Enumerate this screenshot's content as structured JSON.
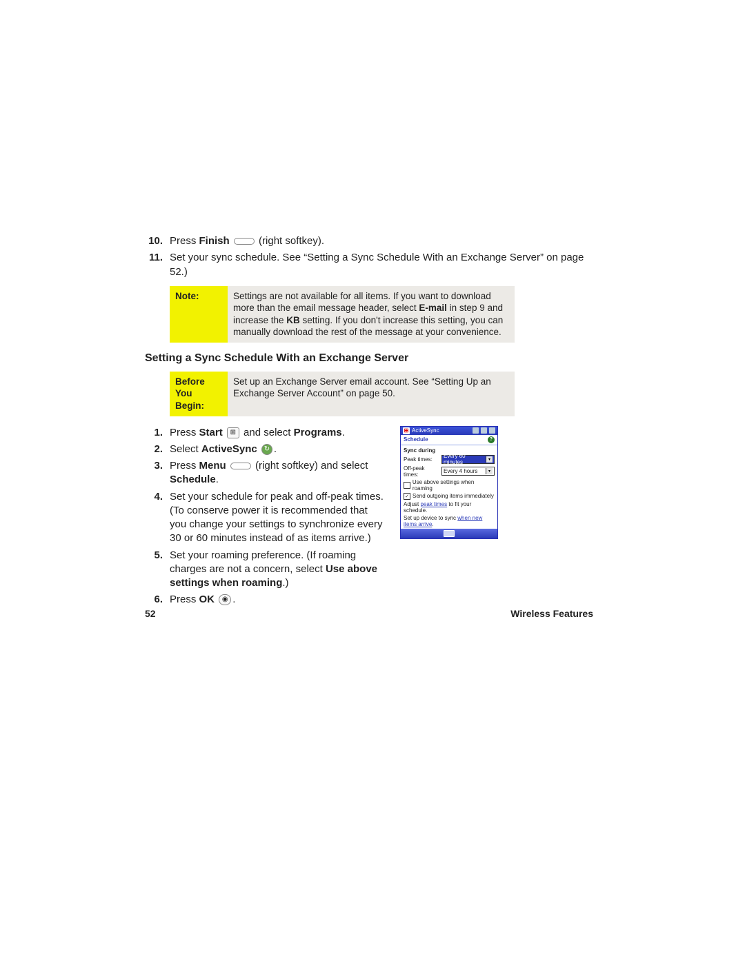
{
  "top_steps": [
    {
      "num": "10.",
      "parts": [
        {
          "t": "Press "
        },
        {
          "t": "Finish",
          "b": true
        },
        {
          "t": " "
        },
        {
          "icon": "softkey"
        },
        {
          "t": " (right softkey)."
        }
      ]
    },
    {
      "num": "11.",
      "parts": [
        {
          "t": "Set your sync schedule. See “Setting a Sync Schedule With an Exchange Server” on page 52.)"
        }
      ]
    }
  ],
  "note": {
    "label": "Note:",
    "body_parts": [
      {
        "t": "Settings are not available for all items. If you want to download more than the email message header, select "
      },
      {
        "t": "E-mail",
        "b": true
      },
      {
        "t": " in step 9 and increase the "
      },
      {
        "t": "KB",
        "b": true
      },
      {
        "t": " setting. If you don't increase this setting, you can manually download the rest of the message at your convenience."
      }
    ]
  },
  "section_heading": "Setting a Sync Schedule With an Exchange Server",
  "before": {
    "label": "Before You Begin:",
    "body": "Set up an Exchange Server email account. See “Setting Up an Exchange Server Account” on page 50."
  },
  "main_steps": [
    {
      "num": "1.",
      "parts": [
        {
          "t": "Press "
        },
        {
          "t": "Start",
          "b": true
        },
        {
          "t": " "
        },
        {
          "icon": "start"
        },
        {
          "t": " and select "
        },
        {
          "t": "Programs",
          "b": true
        },
        {
          "t": "."
        }
      ]
    },
    {
      "num": "2.",
      "parts": [
        {
          "t": "Select "
        },
        {
          "t": "ActiveSync",
          "b": true
        },
        {
          "t": " "
        },
        {
          "icon": "sync"
        },
        {
          "t": "."
        }
      ]
    },
    {
      "num": "3.",
      "parts": [
        {
          "t": "Press "
        },
        {
          "t": "Menu",
          "b": true
        },
        {
          "t": " "
        },
        {
          "icon": "softkey"
        },
        {
          "t": " (right softkey) and select "
        },
        {
          "t": "Schedule",
          "b": true
        },
        {
          "t": "."
        }
      ]
    },
    {
      "num": "4.",
      "parts": [
        {
          "t": "Set your schedule for peak and off-peak times. (To conserve power it is recommended that you change your settings to synchronize every 30 or 60 minutes instead of as items arrive.)"
        }
      ]
    },
    {
      "num": "5.",
      "parts": [
        {
          "t": "Set your roaming preference. (If roaming charges are not a concern, select "
        },
        {
          "t": "Use above settings when roaming",
          "b": true
        },
        {
          "t": ".)"
        }
      ]
    },
    {
      "num": "6.",
      "parts": [
        {
          "t": "Press "
        },
        {
          "t": "OK",
          "b": true
        },
        {
          "t": " "
        },
        {
          "icon": "ok"
        },
        {
          "t": "."
        }
      ]
    }
  ],
  "device": {
    "title": "ActiveSync",
    "subtitle": "Schedule",
    "group": "Sync during",
    "row_peak_label": "Peak times:",
    "row_peak_value": "Every 60 minutes",
    "row_offpeak_label": "Off-peak times:",
    "row_offpeak_value": "Every 4 hours",
    "check1_checked": false,
    "check1_label": "Use above settings when roaming",
    "check2_checked": true,
    "check2_label": "Send outgoing items immediately",
    "hint1_pre": "Adjust ",
    "hint1_link": "peak times",
    "hint1_post": " to fit your schedule.",
    "hint2_pre": "Set up device to sync ",
    "hint2_link": "when new items arrive",
    "hint2_post": "."
  },
  "footer": {
    "page": "52",
    "section": "Wireless Features"
  }
}
